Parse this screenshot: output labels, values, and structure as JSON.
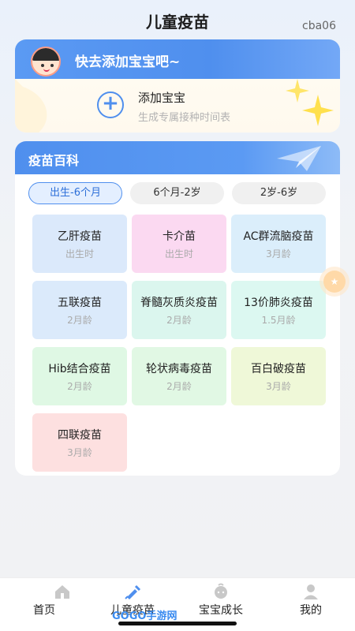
{
  "header": {
    "title": "儿童疫苗",
    "user_id": "cba06"
  },
  "add_card": {
    "banner_text": "快去添加宝宝吧~",
    "add_title": "添加宝宝",
    "add_subtitle": "生成专属接种时间表"
  },
  "encyclopedia": {
    "title": "疫苗百科",
    "tabs": [
      {
        "label": "出生-6个月",
        "active": true
      },
      {
        "label": "6个月-2岁",
        "active": false
      },
      {
        "label": "2岁-6岁",
        "active": false
      }
    ],
    "vaccines": [
      {
        "name": "乙肝疫苗",
        "age": "出生时",
        "color": "#dbe9fb"
      },
      {
        "name": "卡介苗",
        "age": "出生时",
        "color": "#fbd9f1"
      },
      {
        "name": "AC群流脑疫苗",
        "age": "3月龄",
        "color": "#dbeefb"
      },
      {
        "name": "五联疫苗",
        "age": "2月龄",
        "color": "#dbeafb"
      },
      {
        "name": "脊髓灰质炎疫苗",
        "age": "2月龄",
        "color": "#dbf6ee"
      },
      {
        "name": "13价肺炎疫苗",
        "age": "1.5月龄",
        "color": "#dcf8f1"
      },
      {
        "name": "Hib结合疫苗",
        "age": "2月龄",
        "color": "#dff8e4"
      },
      {
        "name": "轮状病毒疫苗",
        "age": "2月龄",
        "color": "#e1f8e4"
      },
      {
        "name": "百白破疫苗",
        "age": "3月龄",
        "color": "#eff8d8"
      },
      {
        "name": "四联疫苗",
        "age": "3月龄",
        "color": "#fde0e0"
      }
    ]
  },
  "nav": {
    "items": [
      {
        "label": "首页",
        "icon": "home-icon"
      },
      {
        "label": "儿童疫苗",
        "icon": "syringe-icon",
        "active": true
      },
      {
        "label": "宝宝成长",
        "icon": "baby-icon"
      },
      {
        "label": "我的",
        "icon": "user-icon"
      }
    ]
  },
  "watermark": "GOGO手游网",
  "colors": {
    "accent": "#4f8fee"
  }
}
